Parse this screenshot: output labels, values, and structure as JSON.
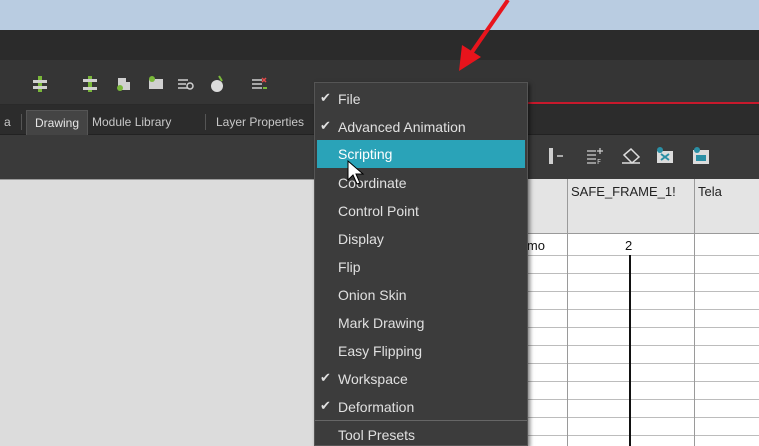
{
  "tabs": [
    {
      "label": "a"
    },
    {
      "label": "Drawing"
    },
    {
      "label": "Module Library"
    },
    {
      "label": "Layer Properties"
    }
  ],
  "toolbar_icons": [
    "add-drawing-icon",
    "insert-drawing-icon",
    "duplicate-drawing-icon",
    "clone-icon",
    "motion-tool-icon",
    "onion-skin-icon",
    "delete-drawing-icon"
  ],
  "sub_toolbar_icons": [
    "column-icon",
    "add-column-icon",
    "fill-icon",
    "delete-column-icon",
    "export-icon"
  ],
  "menu": {
    "items": [
      {
        "label": "File",
        "checked": true
      },
      {
        "label": "Advanced Animation",
        "checked": true
      },
      {
        "label": "Scripting",
        "checked": false,
        "highlighted": true
      },
      {
        "label": "Coordinate",
        "checked": false
      },
      {
        "label": "Control Point",
        "checked": false
      },
      {
        "label": "Display",
        "checked": false
      },
      {
        "label": "Flip",
        "checked": false
      },
      {
        "label": "Onion Skin",
        "checked": false
      },
      {
        "label": "Mark Drawing",
        "checked": false
      },
      {
        "label": "Easy Flipping",
        "checked": false
      },
      {
        "label": "Workspace",
        "checked": true
      },
      {
        "label": "Deformation",
        "checked": true
      },
      {
        "label": "Tool Presets",
        "checked": false
      }
    ],
    "check_glyph": "✔"
  },
  "xsheet": {
    "columns": [
      {
        "header": ""
      },
      {
        "header": "SAFE_FRAME_1!"
      },
      {
        "header": "Tela"
      }
    ],
    "first_row": [
      "imo",
      "2",
      ""
    ]
  },
  "colors": {
    "highlight": "#2aa3b8",
    "titlebar": "#b9cce1",
    "accent_red": "#c8192c",
    "arrow": "#e8141c"
  }
}
